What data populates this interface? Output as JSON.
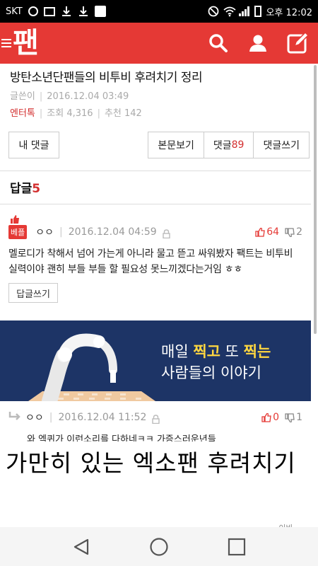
{
  "status_bar": {
    "carrier": "SKT",
    "time": "오후 12:02"
  },
  "app": {
    "logo": "팬"
  },
  "article": {
    "title": "방탄소년단팬들의 비투비 후려치기 정리",
    "author": "글쓴이",
    "date": "2016.12.04 03:49",
    "category": "엔터톡",
    "views": "조회 4,316",
    "recommends": "추천 142"
  },
  "buttons": {
    "my_comments": "내 댓글",
    "view_body": "본문보기",
    "comments_label": "댓글",
    "comments_count": "89",
    "write_comment": "댓글쓰기"
  },
  "replies": {
    "label": "답글",
    "count": "5"
  },
  "comment1": {
    "badge": "베플",
    "user": "ㅇㅇ",
    "date": "2016.12.04 04:59",
    "likes": "64",
    "dislikes": "2",
    "body": "멜로디가 착해서 넘어 가는게 아니라 물고 뜯고 싸워봤자 팩트는 비투비 실력이야 괜히 부들 부들 할 필요성 못느끼겠다는거임 ㅎㅎ",
    "reply_button": "답글쓰기"
  },
  "banner": {
    "line1_pre": "매일 ",
    "line1_hl1": "찍고",
    "line1_mid": " 또 ",
    "line1_hl2": "찍는",
    "line2": "사람들의 이야기"
  },
  "comment2": {
    "user": "ㅇㅇ",
    "date": "2016.12.04 11:52",
    "likes": "0",
    "dislikes": "1",
    "body": "와 엑퀴가 이런소리를 다하네ㅋㅋ 가증스러운년들"
  },
  "overlay_caption": "가만히 있는 엑소팬 후려치기",
  "trailing_text": "~~이바",
  "colors": {
    "brand_red": "#e53935",
    "banner_navy": "#1d3466",
    "highlight_yellow": "#ffd740"
  }
}
